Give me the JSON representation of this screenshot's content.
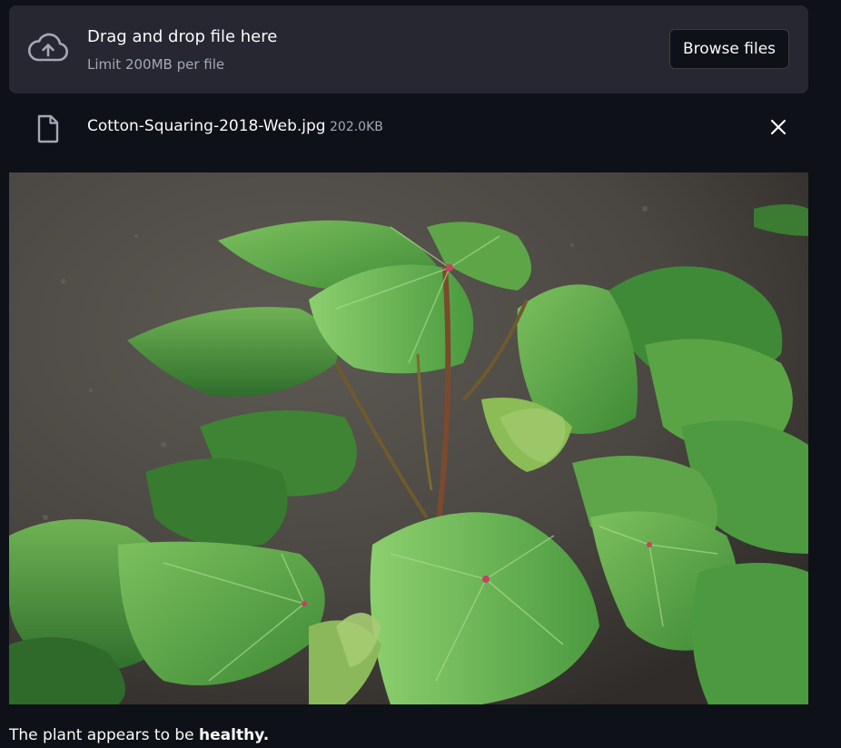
{
  "uploader": {
    "title": "Drag and drop file here",
    "limit": "Limit 200MB per file",
    "browse_label": "Browse files",
    "upload_icon": "cloud-upload-icon"
  },
  "file": {
    "name": "Cotton-Squaring-2018-Web.jpg",
    "size": "202.0KB",
    "file_icon": "file-icon",
    "remove_icon": "close-icon"
  },
  "image": {
    "subject": "cotton plant photo"
  },
  "result": {
    "prefix": "The plant appears to be ",
    "status": "healthy."
  },
  "colors": {
    "background": "#0e1117",
    "panel": "#262730",
    "text": "#fafafa",
    "muted": "#a3a8b8"
  }
}
